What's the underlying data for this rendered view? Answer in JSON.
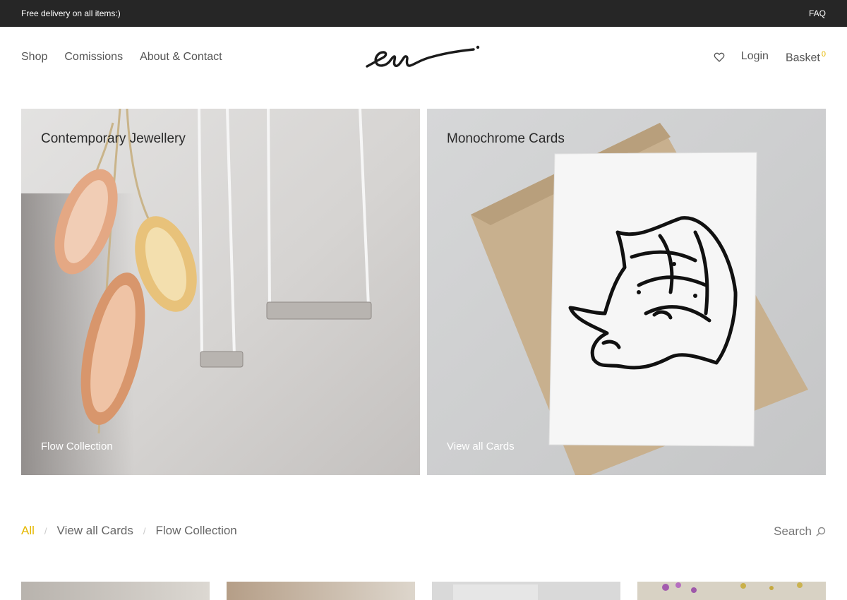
{
  "topbar": {
    "promo": "Free delivery on all items:)",
    "faq": "FAQ"
  },
  "nav": {
    "left": [
      {
        "label": "Shop"
      },
      {
        "label": "Comissions"
      },
      {
        "label": "About & Contact"
      }
    ],
    "logo_icon": "signature-logo",
    "wishlist_icon": "heart-icon",
    "login": "Login",
    "basket": "Basket",
    "basket_count": "0"
  },
  "tiles": [
    {
      "title": "Contemporary Jewellery",
      "link": "Flow Collection"
    },
    {
      "title": "Monochrome Cards",
      "link": "View all Cards"
    }
  ],
  "filters": {
    "items": [
      {
        "label": "All",
        "active": true
      },
      {
        "label": "View all Cards",
        "active": false
      },
      {
        "label": "Flow Collection",
        "active": false
      }
    ],
    "separator": "/"
  },
  "search": {
    "label": "Search",
    "icon": "search-icon"
  },
  "colors": {
    "accent": "#e6b800",
    "topbar": "#262626"
  }
}
